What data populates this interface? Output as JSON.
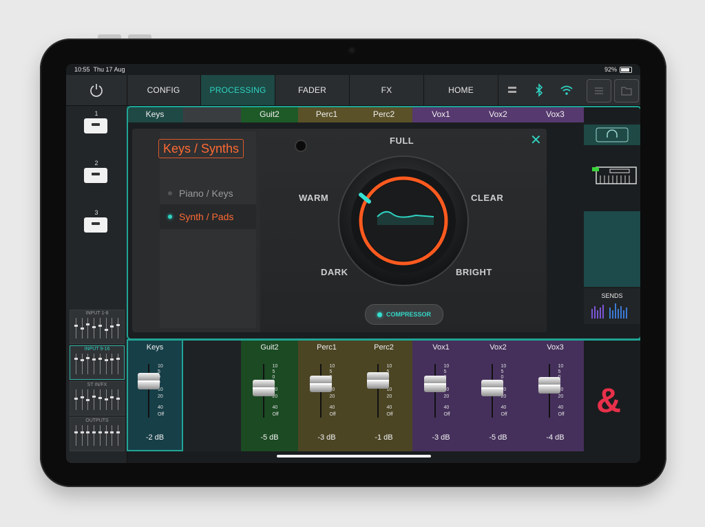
{
  "status": {
    "time": "10:55",
    "date": "Thu 17 Aug",
    "battery": "92%"
  },
  "nav": {
    "tabs": [
      "CONFIG",
      "PROCESSING",
      "FADER",
      "FX",
      "HOME"
    ],
    "active": "PROCESSING"
  },
  "scenes": [
    "1",
    "2",
    "3"
  ],
  "banks": [
    "INPUT 1-8",
    "INPUT 9-16",
    "ST IN/FX",
    "OUTPUTS"
  ],
  "channels": [
    {
      "name": "Keys",
      "db": "-2 dB",
      "color": "#173f48",
      "pos": 0.22
    },
    {
      "name": "",
      "db": "",
      "color": "#1f2224",
      "pos": null
    },
    {
      "name": "Guit2",
      "db": "-5 dB",
      "color": "#1b4a23",
      "pos": 0.34
    },
    {
      "name": "Perc1",
      "db": "-3 dB",
      "color": "#4b4524",
      "pos": 0.27
    },
    {
      "name": "Perc2",
      "db": "-1 dB",
      "color": "#4b4524",
      "pos": 0.2
    },
    {
      "name": "Vox1",
      "db": "-3 dB",
      "color": "#45305b",
      "pos": 0.27
    },
    {
      "name": "Vox2",
      "db": "-5 dB",
      "color": "#45305b",
      "pos": 0.34
    },
    {
      "name": "Vox3",
      "db": "-4 dB",
      "color": "#45305b",
      "pos": 0.3
    }
  ],
  "fader_scale": [
    "10",
    "5",
    "0",
    "5",
    "10",
    "20",
    "40",
    "Off"
  ],
  "preset": {
    "category": "Keys / Synths",
    "items": [
      {
        "label": "Piano / Keys",
        "active": false
      },
      {
        "label": "Synth / Pads",
        "active": true
      }
    ]
  },
  "dial": {
    "top": "FULL",
    "left_upper": "WARM",
    "right_upper": "CLEAR",
    "left_lower": "DARK",
    "right_lower": "BRIGHT"
  },
  "compressor_label": "COMPRESSOR",
  "sends_label": "SENDS",
  "accent": "#2fd3c2",
  "orange": "#ff5a1f"
}
